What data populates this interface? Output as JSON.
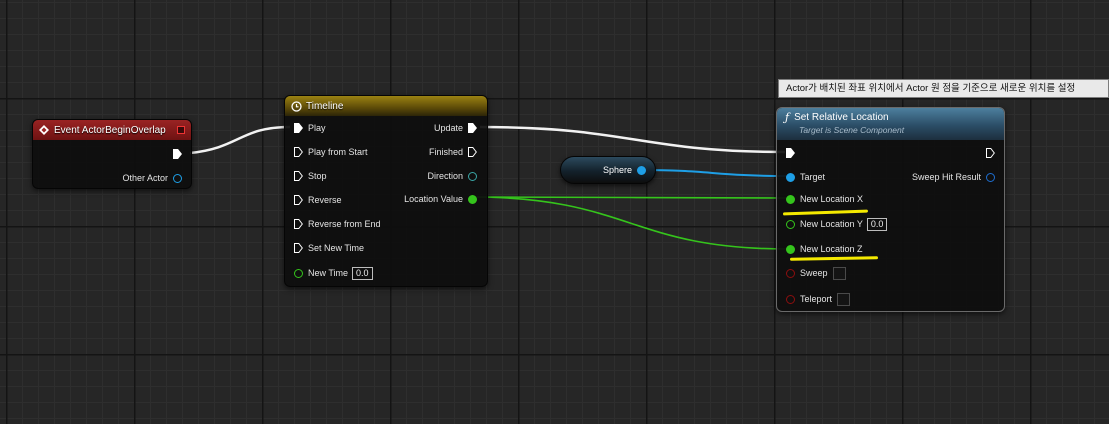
{
  "tooltip": {
    "text": "Actor가 배치된 좌표 위치에서 Actor 원 점을 기준으로 새로운 위치를 설정"
  },
  "event_node": {
    "title": "Event ActorBeginOverlap",
    "outputs": {
      "other_actor": "Other Actor"
    },
    "colors": {
      "header": "#8a1b1b"
    }
  },
  "timeline_node": {
    "title": "Timeline",
    "inputs": {
      "play": "Play",
      "play_from_start": "Play from Start",
      "stop": "Stop",
      "reverse": "Reverse",
      "reverse_from_end": "Reverse from End",
      "set_new_time": "Set New Time",
      "new_time": "New Time",
      "new_time_value": "0.0"
    },
    "outputs": {
      "update": "Update",
      "finished": "Finished",
      "direction": "Direction",
      "location_value": "Location Value"
    },
    "colors": {
      "header": "#8a7410"
    }
  },
  "sphere_node": {
    "label": "Sphere"
  },
  "set_location_node": {
    "title": "Set Relative Location",
    "subtitle": "Target is Scene Component",
    "inputs": {
      "target": "Target",
      "new_location_x": "New Location X",
      "new_location_y": "New Location Y",
      "new_location_y_value": "0.0",
      "new_location_z": "New Location Z",
      "sweep": "Sweep",
      "teleport": "Teleport"
    },
    "outputs": {
      "sweep_hit_result": "Sweep Hit Result"
    },
    "colors": {
      "header": "#3e6a8a"
    }
  },
  "pin_colors": {
    "exec": "#ffffff",
    "object": "#1e9fe6",
    "float": "#35c41c",
    "bool": "#8c0f0f",
    "struct": "#1e6ed0"
  }
}
